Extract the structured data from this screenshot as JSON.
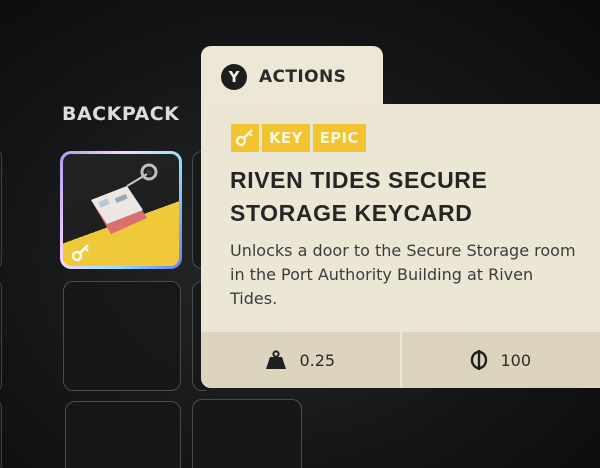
{
  "backpack": {
    "title": "BACKPACK"
  },
  "actions_tab": {
    "button_glyph": "Y",
    "label": "ACTIONS"
  },
  "item": {
    "tags": [
      "KEY",
      "EPIC"
    ],
    "name_line1": "RIVEN TIDES SECURE",
    "name_line2": "STORAGE KEYCARD",
    "description": "Unlocks a door to the Secure Storage room in the Port Authority Building at Riven Tides.",
    "weight": "0.25",
    "value": "100",
    "type_icon": "key-icon",
    "weight_icon": "weight-icon",
    "currency_icon": "coin-icon"
  },
  "colors": {
    "card_bg": "#ece6d5",
    "stats_bg": "#dcd4bf",
    "epic_yellow": "#f2c431",
    "text_dark": "#262626"
  }
}
